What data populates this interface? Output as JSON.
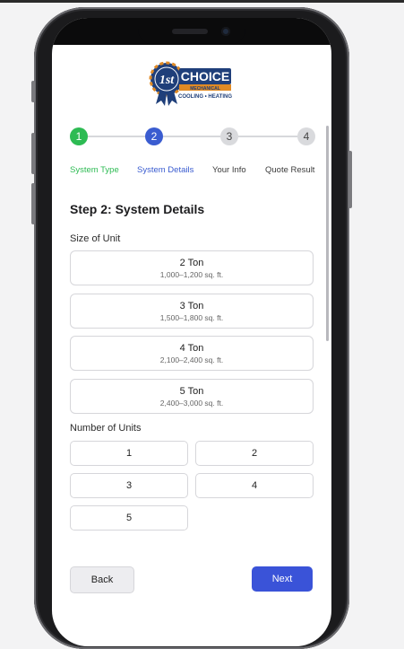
{
  "logo": {
    "badge_text": "1st",
    "brand_name": "CHOICE",
    "tagline_1": "MECHANICAL",
    "tagline_2": "COOLING • HEATING"
  },
  "stepper": {
    "steps": [
      {
        "number": "1",
        "label": "System Type",
        "state": "completed",
        "color": "#2dbb53"
      },
      {
        "number": "2",
        "label": "System Details",
        "state": "current",
        "color": "#3a5cd0"
      },
      {
        "number": "3",
        "label": "Your Info",
        "state": "upcoming",
        "color": "#d9dadd"
      },
      {
        "number": "4",
        "label": "Quote Result",
        "state": "upcoming",
        "color": "#d9dadd"
      }
    ]
  },
  "form": {
    "title": "Step 2: System Details",
    "size_section_label": "Size of Unit",
    "size_options": [
      {
        "title": "2 Ton",
        "subtitle": "1,000–1,200 sq. ft."
      },
      {
        "title": "3 Ton",
        "subtitle": "1,500–1,800 sq. ft."
      },
      {
        "title": "4 Ton",
        "subtitle": "2,100–2,400 sq. ft."
      },
      {
        "title": "5 Ton",
        "subtitle": "2,400–3,000 sq. ft."
      }
    ],
    "units_section_label": "Number of Units",
    "unit_options": [
      "1",
      "2",
      "3",
      "4",
      "5"
    ]
  },
  "nav": {
    "back_label": "Back",
    "next_label": "Next"
  },
  "colors": {
    "accent": "#3a53d8",
    "success": "#2dbb53",
    "current_step": "#3a5cd0"
  }
}
